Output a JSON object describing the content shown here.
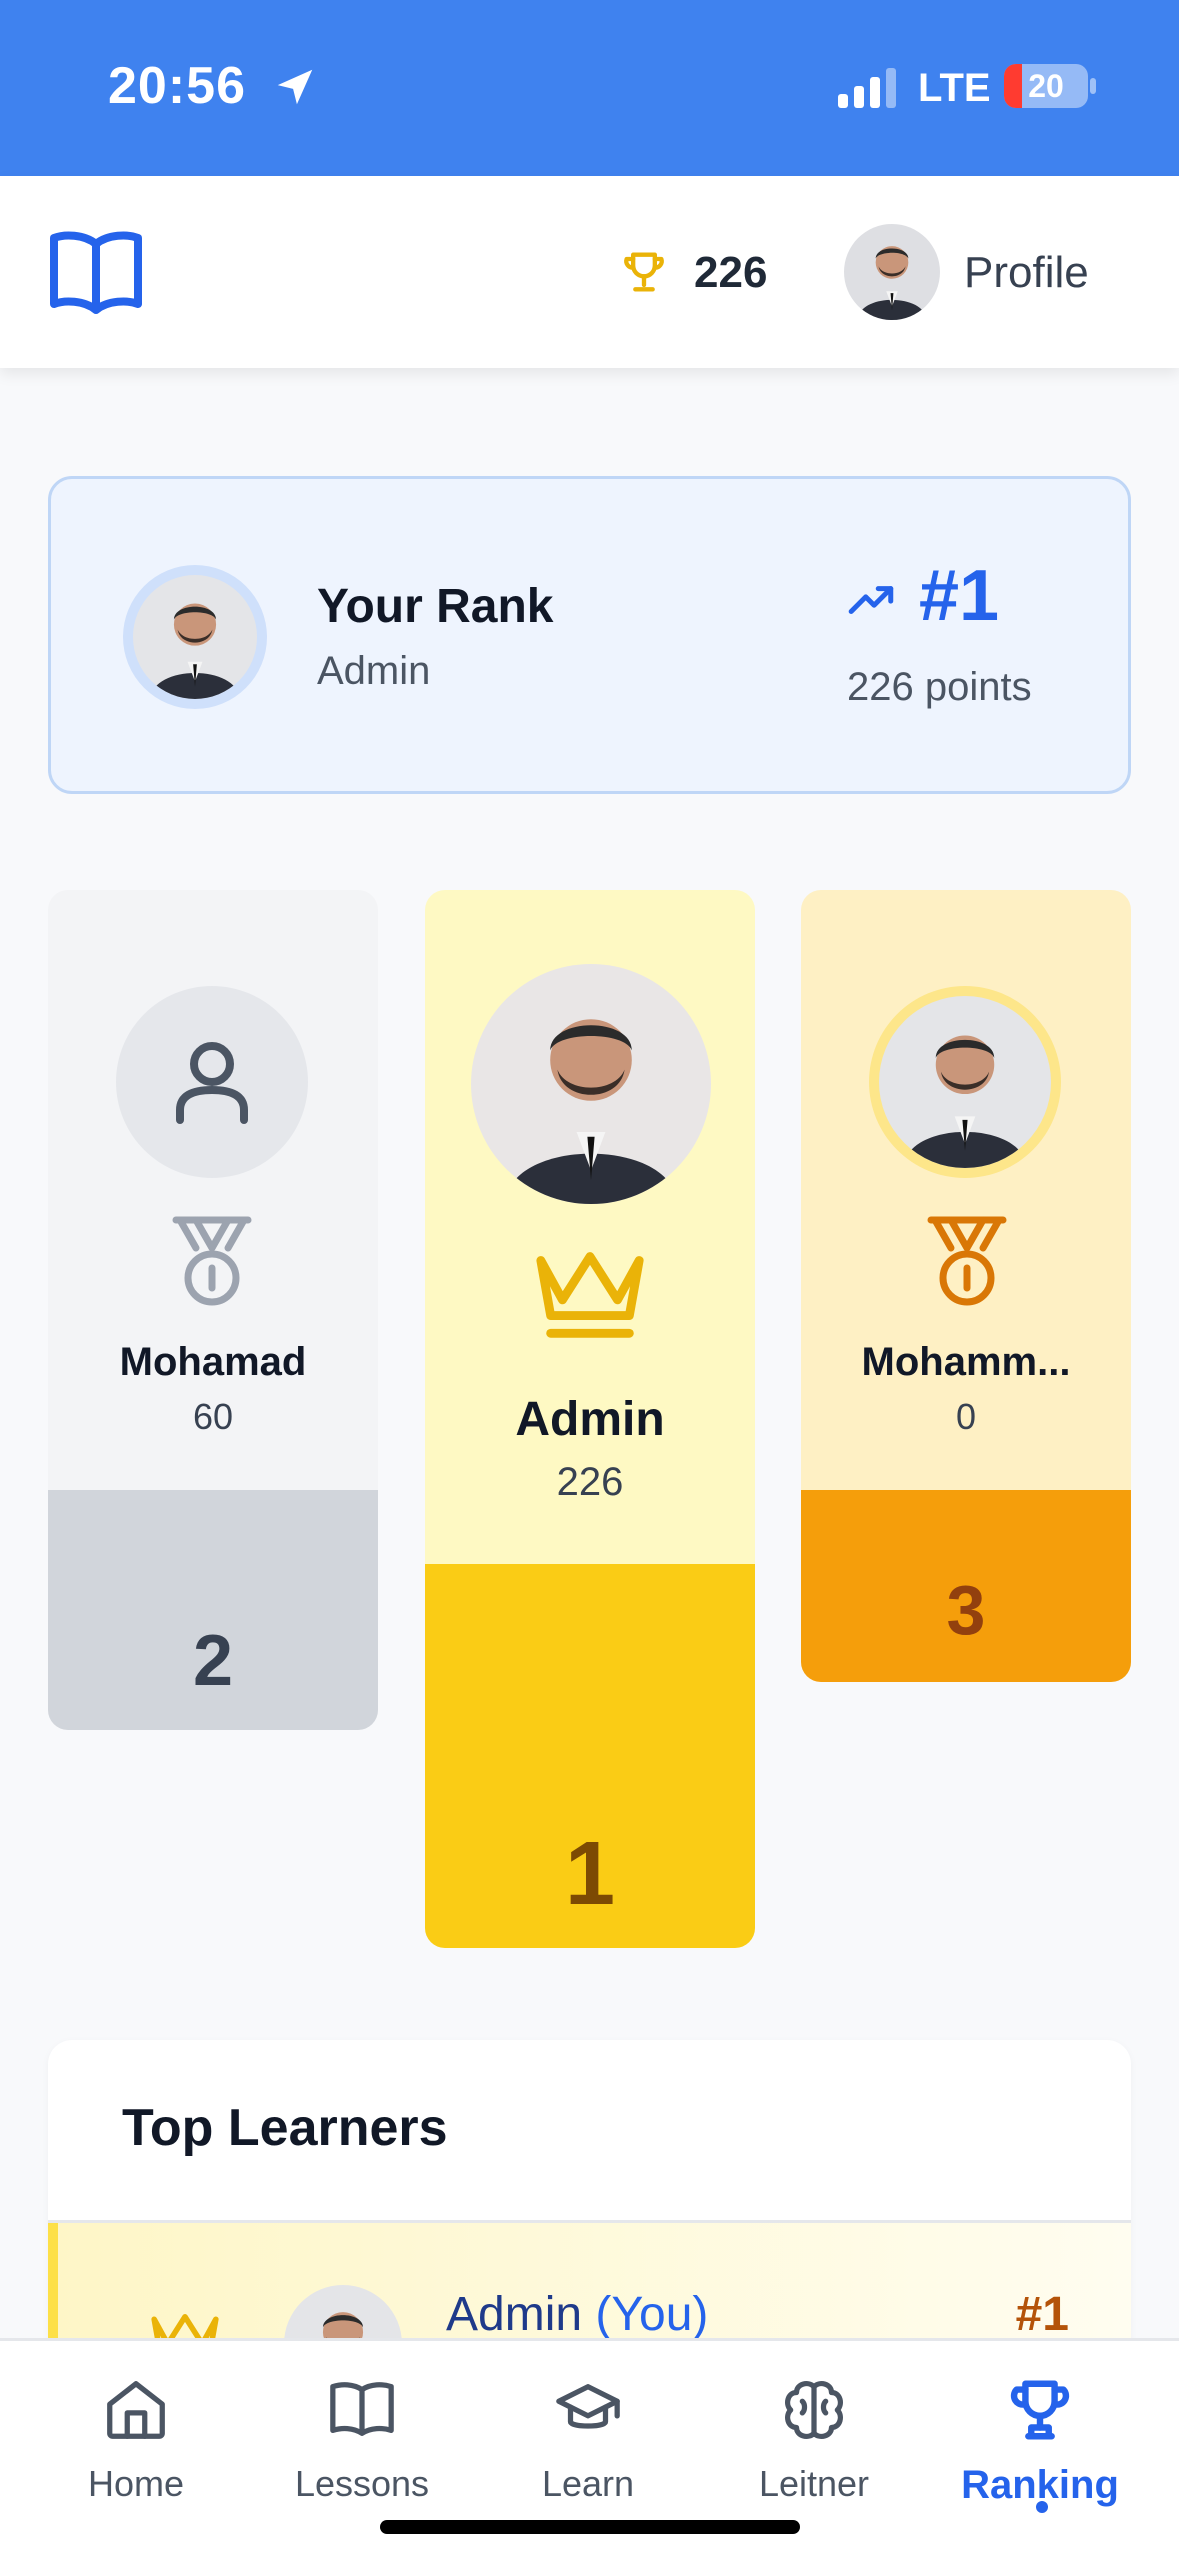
{
  "status_bar": {
    "time": "20:56",
    "network": "LTE",
    "battery": "20"
  },
  "header": {
    "points": "226",
    "profile_label": "Profile"
  },
  "your_rank": {
    "title": "Your Rank",
    "username": "Admin",
    "rank": "#1",
    "points": "226 points"
  },
  "podium": {
    "first": {
      "name": "Admin",
      "score": "226",
      "place": "1"
    },
    "second": {
      "name": "Mohamad",
      "score": "60",
      "place": "2"
    },
    "third": {
      "name": "Mohamm...",
      "score": "0",
      "place": "3"
    }
  },
  "top_learners": {
    "title": "Top Learners",
    "rows": [
      {
        "name": "Admin",
        "you_tag": "(You)",
        "rank": "#1"
      }
    ]
  },
  "tabs": [
    {
      "label": "Home",
      "icon": "home-icon"
    },
    {
      "label": "Lessons",
      "icon": "book-icon"
    },
    {
      "label": "Learn",
      "icon": "graduation-cap-icon"
    },
    {
      "label": "Leitner",
      "icon": "brain-icon"
    },
    {
      "label": "Ranking",
      "icon": "trophy-icon",
      "active": true
    }
  ],
  "colors": {
    "primary": "#2563eb",
    "status_bar": "#3f82ef",
    "gold": "#facc15",
    "silver": "#d1d5db",
    "bronze": "#f59e0b"
  }
}
